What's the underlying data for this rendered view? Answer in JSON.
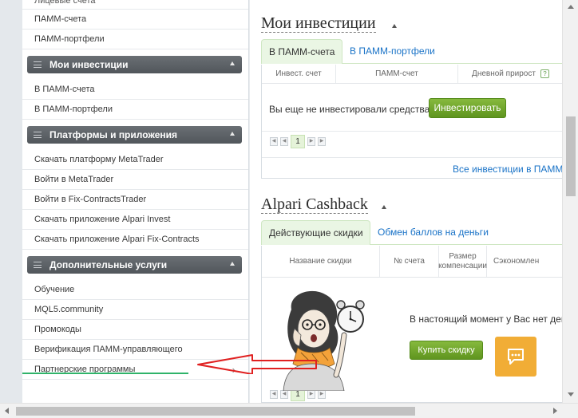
{
  "sidebar": {
    "top_items": [
      "Лицевые счета",
      "ПАММ-счета",
      "ПАММ-портфели"
    ],
    "sections": [
      {
        "title": "Мои инвестиции",
        "items": [
          "В ПАММ-счета",
          "В ПАММ-портфели"
        ]
      },
      {
        "title": "Платформы и приложения",
        "items": [
          "Скачать платформу MetaTrader",
          "Войти в MetaTrader",
          "Войти в Fix-ContractsTrader",
          "Скачать приложение Alpari Invest",
          "Скачать приложение Alpari Fix-Contracts"
        ]
      },
      {
        "title": "Дополнительные услуги",
        "items": [
          "Обучение",
          "MQL5.community",
          "Промокоды",
          "Верификация ПАММ-управляющего",
          "Партнерские программы"
        ]
      }
    ]
  },
  "investments": {
    "title": "Мои инвестиции",
    "tabs": [
      "В ПАММ-счета",
      "В ПАММ-портфели"
    ],
    "columns": [
      "Инвест. счет",
      "ПАММ-счет",
      "Дневной прирост"
    ],
    "help_glyph": "?",
    "empty_text": "Вы еще не инвестировали средства.",
    "invest_button": "Инвестировать",
    "page": "1",
    "all_link": "Все инвестиции в ПАММ-с"
  },
  "cashback": {
    "title": "Alpari Cashback",
    "tabs": [
      "Действующие скидки",
      "Обмен баллов на деньги"
    ],
    "columns": [
      "Название скидки",
      "№ счета",
      "Размер компенсации",
      "Сэкономлен"
    ],
    "empty_text": "В настоящий момент у Вас нет дейс",
    "buy_button": "Купить скидку",
    "page": "1"
  },
  "colors": {
    "accent_green": "#6fa72a",
    "link_blue": "#1a73c7",
    "annotation_red": "#e02020",
    "highlight_green": "#2fb36a",
    "chat_orange": "#f1ad36"
  },
  "icons": [
    "menu-icon",
    "caret-up-icon",
    "chevron-right-icon",
    "help-icon",
    "chat-icon",
    "first-page-icon",
    "prev-page-icon",
    "next-page-icon",
    "last-page-icon"
  ]
}
